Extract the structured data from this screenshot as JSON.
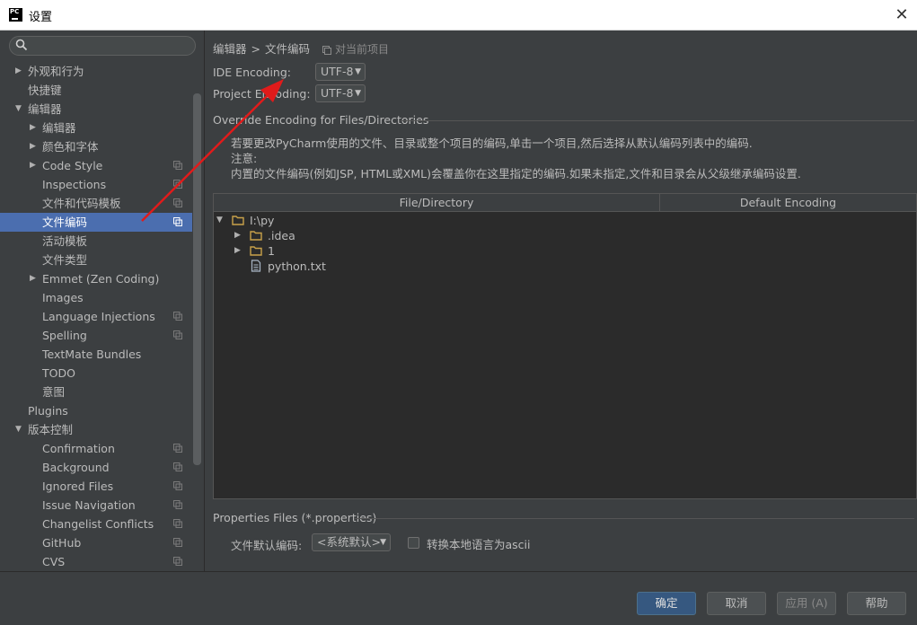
{
  "window": {
    "title": "设置",
    "logo_text": "PC",
    "close_symbol": "✕"
  },
  "sidebar": {
    "search_placeholder": "",
    "items": [
      {
        "label": "外观和行为",
        "level": 0,
        "arrow": "▶",
        "project": false
      },
      {
        "label": "快捷键",
        "level": 0,
        "arrow": "",
        "project": false
      },
      {
        "label": "编辑器",
        "level": 0,
        "arrow": "▼",
        "project": false
      },
      {
        "label": "编辑器",
        "level": 1,
        "arrow": "▶",
        "project": false
      },
      {
        "label": "颜色和字体",
        "level": 1,
        "arrow": "▶",
        "project": false
      },
      {
        "label": "Code Style",
        "level": 1,
        "arrow": "▶",
        "project": true
      },
      {
        "label": "Inspections",
        "level": 1,
        "arrow": "",
        "project": true
      },
      {
        "label": "文件和代码模板",
        "level": 1,
        "arrow": "",
        "project": true
      },
      {
        "label": "文件编码",
        "level": 1,
        "arrow": "",
        "project": true,
        "selected": true
      },
      {
        "label": "活动模板",
        "level": 1,
        "arrow": "",
        "project": false
      },
      {
        "label": "文件类型",
        "level": 1,
        "arrow": "",
        "project": false
      },
      {
        "label": "Emmet (Zen Coding)",
        "level": 1,
        "arrow": "▶",
        "project": false
      },
      {
        "label": "Images",
        "level": 1,
        "arrow": "",
        "project": false
      },
      {
        "label": "Language Injections",
        "level": 1,
        "arrow": "",
        "project": true
      },
      {
        "label": "Spelling",
        "level": 1,
        "arrow": "",
        "project": true
      },
      {
        "label": "TextMate Bundles",
        "level": 1,
        "arrow": "",
        "project": false
      },
      {
        "label": "TODO",
        "level": 1,
        "arrow": "",
        "project": false
      },
      {
        "label": "意图",
        "level": 1,
        "arrow": "",
        "project": false
      },
      {
        "label": "Plugins",
        "level": 0,
        "arrow": "",
        "project": false
      },
      {
        "label": "版本控制",
        "level": 0,
        "arrow": "▼",
        "project": false
      },
      {
        "label": "Confirmation",
        "level": 1,
        "arrow": "",
        "project": true
      },
      {
        "label": "Background",
        "level": 1,
        "arrow": "",
        "project": true
      },
      {
        "label": "Ignored Files",
        "level": 1,
        "arrow": "",
        "project": true
      },
      {
        "label": "Issue Navigation",
        "level": 1,
        "arrow": "",
        "project": true
      },
      {
        "label": "Changelist Conflicts",
        "level": 1,
        "arrow": "",
        "project": true
      },
      {
        "label": "GitHub",
        "level": 1,
        "arrow": "",
        "project": true
      },
      {
        "label": "CVS",
        "level": 1,
        "arrow": "",
        "project": true
      }
    ]
  },
  "main": {
    "breadcrumb": {
      "parent": "编辑器",
      "separator": ">",
      "current": "文件编码",
      "scope": "对当前项目"
    },
    "ide_encoding": {
      "label": "IDE Encoding:",
      "value": "UTF-8"
    },
    "project_encoding": {
      "label": "Project Encoding:",
      "value": "UTF-8"
    },
    "override_title": "Override Encoding for Files/Directories",
    "description": {
      "line1": "若要更改PyCharm使用的文件、目录或整个项目的编码,单击一个项目,然后选择从默认编码列表中的编码.",
      "line2": "注意:",
      "line3": "内置的文件编码(例如JSP, HTML或XML)会覆盖你在这里指定的编码.如果未指定,文件和目录会从父级继承编码设置."
    },
    "table": {
      "columns": [
        "File/Directory",
        "Default Encoding"
      ],
      "rows": [
        {
          "name": "I:\\py",
          "type": "folder",
          "arrow": "▼",
          "depth": 0
        },
        {
          "name": ".idea",
          "type": "folder",
          "arrow": "▶",
          "depth": 1
        },
        {
          "name": "1",
          "type": "folder",
          "arrow": "▶",
          "depth": 1
        },
        {
          "name": "python.txt",
          "type": "file",
          "arrow": "",
          "depth": 1
        }
      ]
    },
    "properties": {
      "title": "Properties Files (*.properties)",
      "encoding_label": "文件默认编码:",
      "encoding_value": "<系统默认>",
      "checkbox_label": "转换本地语言为ascii",
      "checked": false
    }
  },
  "footer": {
    "ok": "确定",
    "cancel": "取消",
    "apply": "应用 (A)",
    "help": "帮助"
  },
  "colors": {
    "background": "#3c3f41",
    "selection": "#4b6eaf",
    "primary_button": "#365880",
    "annotation_arrow": "#e01b1b",
    "folder": "#c9a24a"
  }
}
